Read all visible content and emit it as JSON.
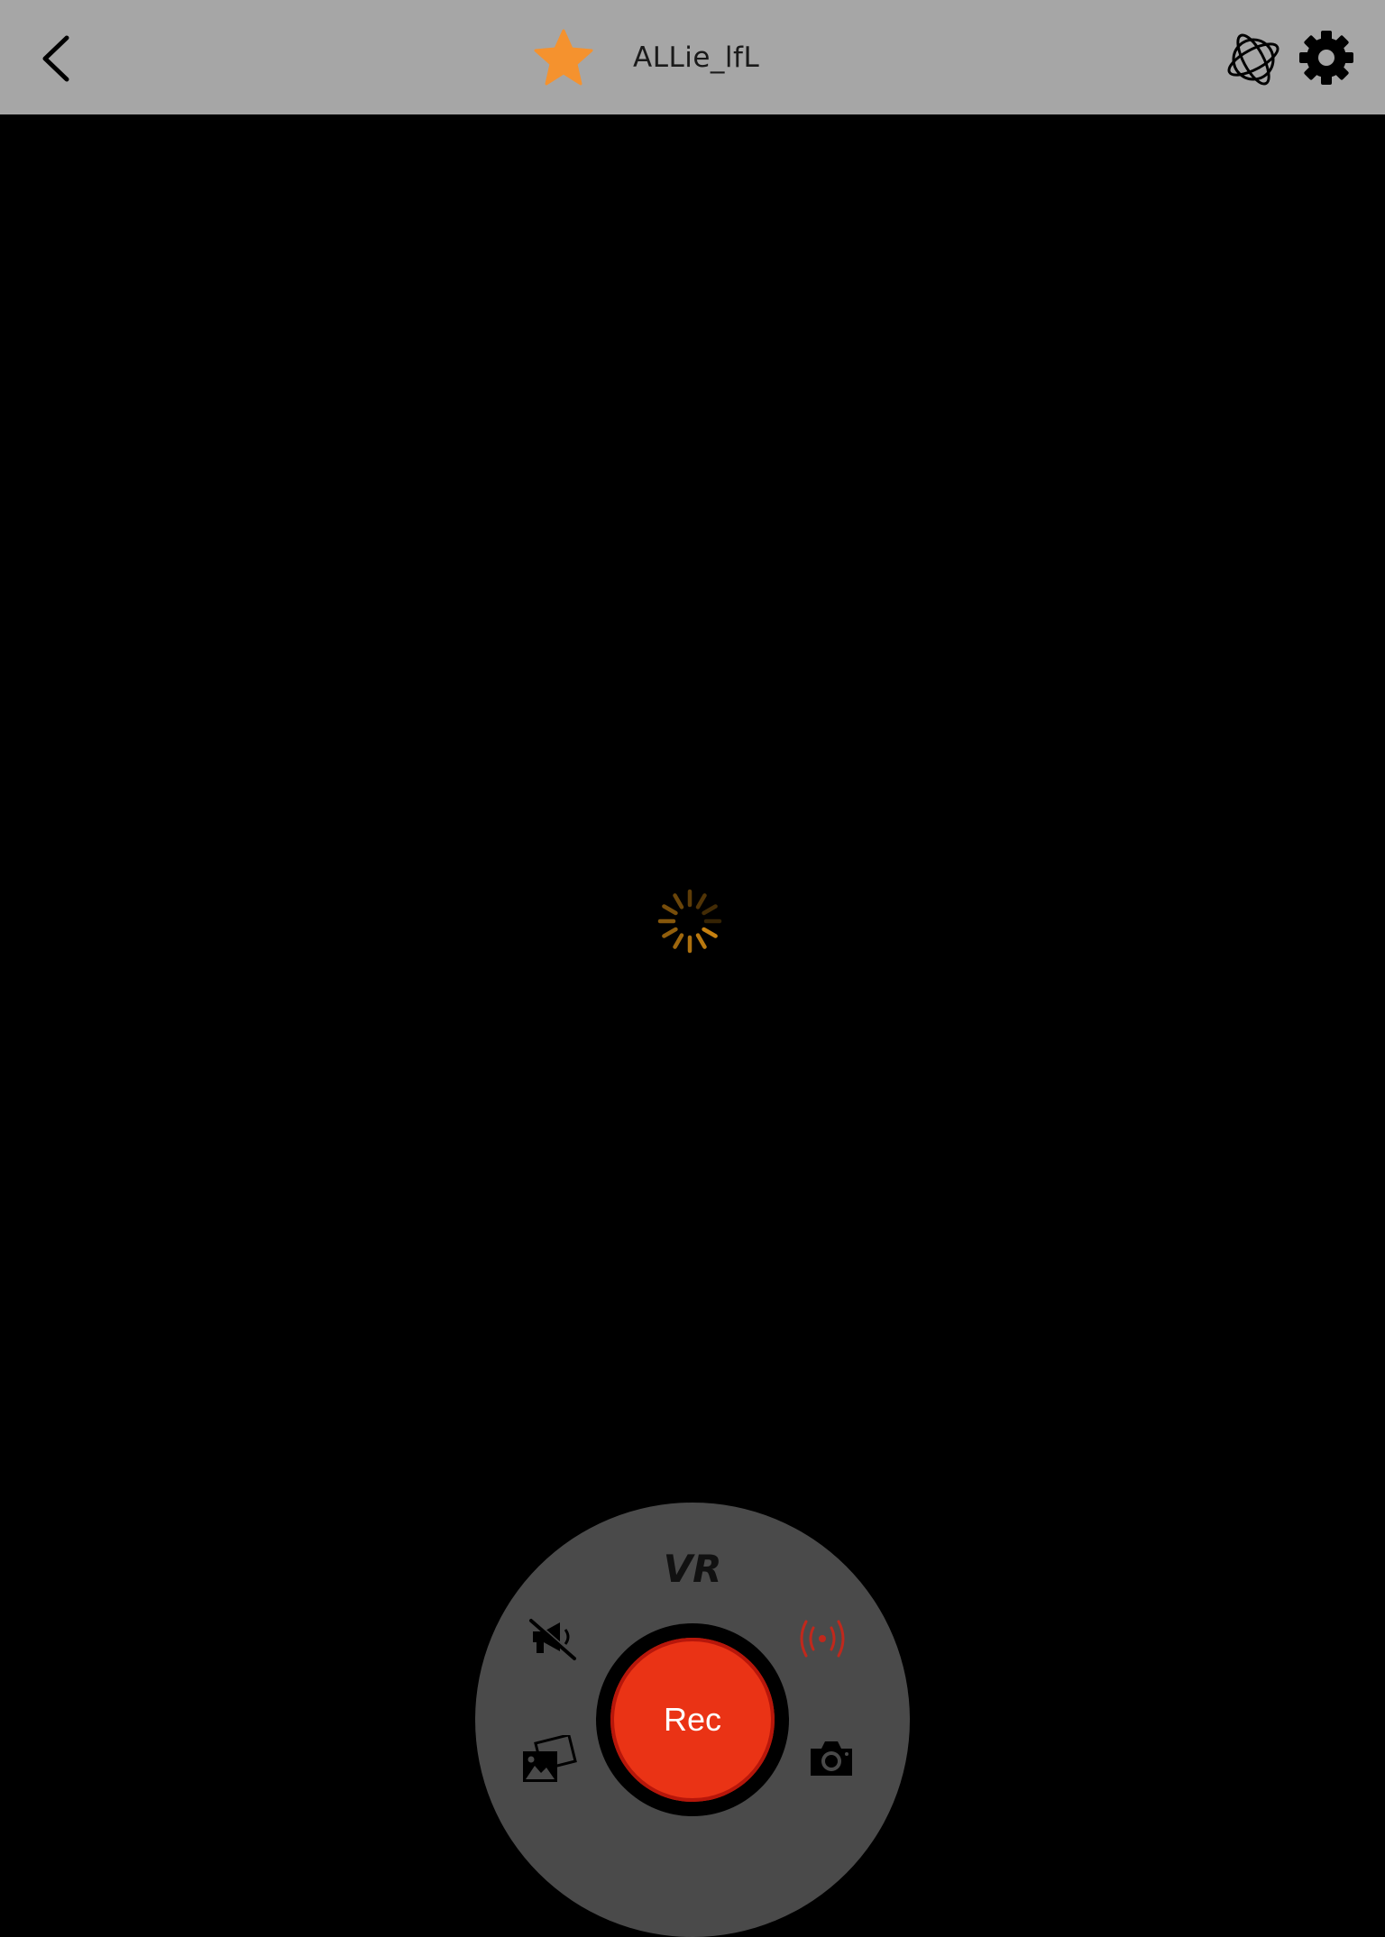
{
  "header": {
    "title": "ALLie_lfL",
    "back_icon": "chevron-left-icon",
    "favorite_icon": "star-icon",
    "vr_icon": "orbit-sphere-icon",
    "settings_icon": "gear-icon"
  },
  "viewport": {
    "status": "loading",
    "spinner_icon": "activity-spinner-icon"
  },
  "controls": {
    "mode_label": "VR",
    "record_label": "Rec",
    "mute_icon": "megaphone-muted-icon",
    "live_icon": "broadcast-icon",
    "gallery_icon": "photo-gallery-icon",
    "camera_icon": "camera-icon"
  },
  "colors": {
    "header_bg": "#a6a6a6",
    "accent_star": "#f5922e",
    "record_red": "#ea3315",
    "live_red": "#c0281c",
    "dial_bg": "#4a4a4a",
    "spinner": "#d48a12"
  }
}
